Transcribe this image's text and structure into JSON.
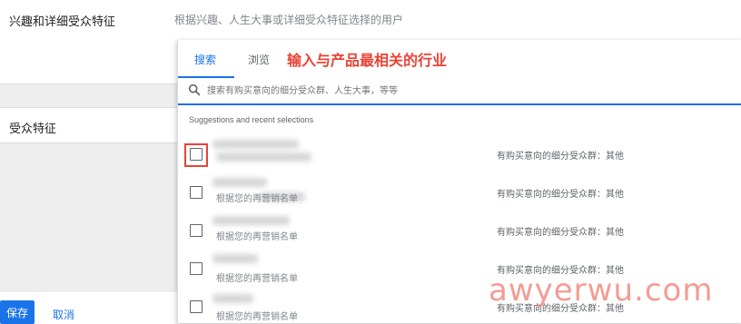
{
  "section1": {
    "label": "兴趣和详细受众特征",
    "description": "根据兴趣、人生大事或详细受众特征选择的用户"
  },
  "section2": {
    "label": "受众特征"
  },
  "actions": {
    "save": "保存",
    "cancel": "取消"
  },
  "panel": {
    "tabs": [
      {
        "label": "搜索",
        "active": true
      },
      {
        "label": "浏览",
        "active": false
      }
    ],
    "annotation": "输入与产品最相关的行业",
    "search_placeholder": "搜索有购买意向的细分受众群、人生大事，等等",
    "suggestions_header": "Suggestions and recent selections",
    "items": [
      {
        "subtitle": "",
        "category": "有购买意向的细分受众群：其他",
        "highlighted": true
      },
      {
        "subtitle": "根据您的再营销名单",
        "category": "有购买意向的细分受众群：其他",
        "highlighted": false
      },
      {
        "subtitle": "根据您的再营销名单",
        "category": "有购买意向的细分受众群：其他",
        "highlighted": false
      },
      {
        "subtitle": "根据您的再营销名单",
        "category": "有购买意向的细分受众群：其他",
        "highlighted": false
      },
      {
        "subtitle": "根据您的再营销名单",
        "category": "有购买意向的细分受众群：其他",
        "highlighted": false
      }
    ]
  },
  "watermark": "awyerwu.com",
  "colors": {
    "accent": "#1a73e8",
    "annotation": "#ea4335"
  }
}
